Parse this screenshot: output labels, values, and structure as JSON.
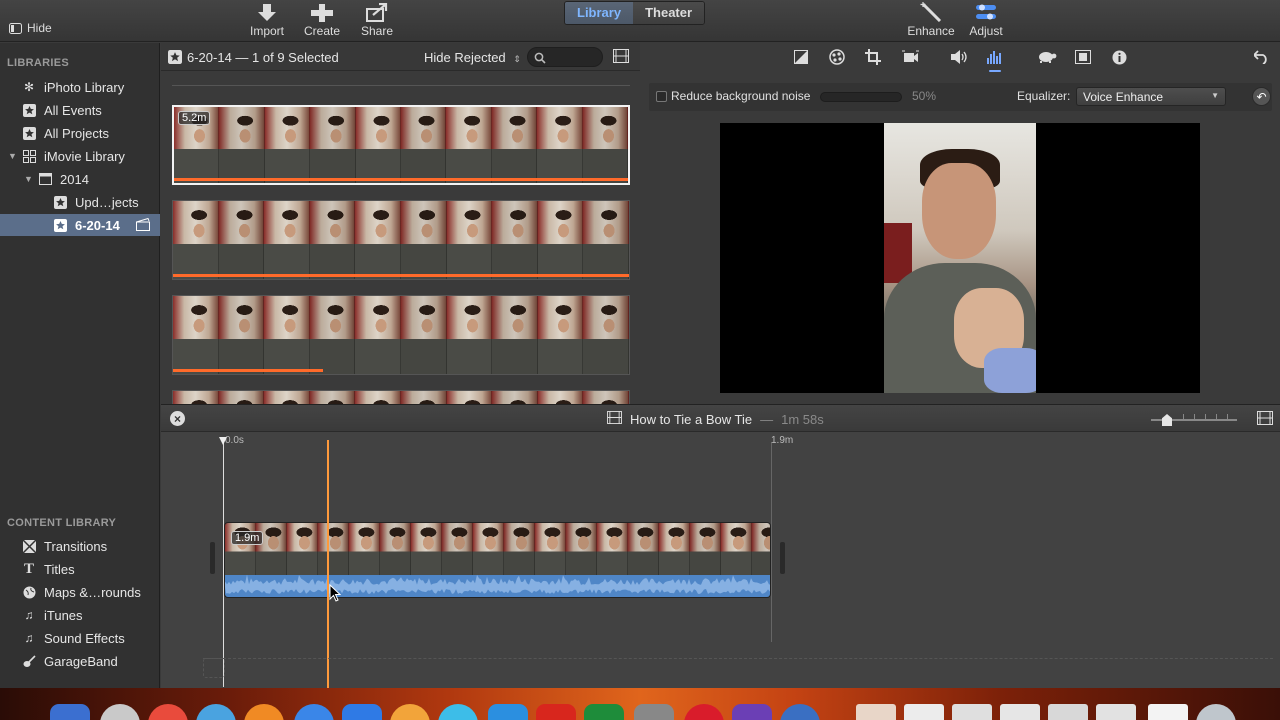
{
  "toolbar": {
    "hide_label": "Hide",
    "import_label": "Import",
    "create_label": "Create",
    "share_label": "Share",
    "library_tab": "Library",
    "theater_tab": "Theater",
    "enhance_label": "Enhance",
    "adjust_label": "Adjust"
  },
  "sidebar": {
    "libraries_header": "LIBRARIES",
    "items": [
      {
        "label": "iPhoto Library",
        "icon": "iphoto-icon"
      },
      {
        "label": "All Events",
        "icon": "star-icon"
      },
      {
        "label": "All Projects",
        "icon": "star-icon"
      },
      {
        "label": "iMovie Library",
        "icon": "grid-icon"
      },
      {
        "label": "2014",
        "icon": "calendar-icon"
      },
      {
        "label": "Upd…jects",
        "icon": "star-icon"
      },
      {
        "label": "6-20-14",
        "icon": "star-icon",
        "selected": true
      }
    ],
    "content_header": "CONTENT LIBRARY",
    "content_items": [
      {
        "label": "Transitions",
        "icon": "transitions-icon"
      },
      {
        "label": "Titles",
        "icon": "titles-icon"
      },
      {
        "label": "Maps &…rounds",
        "icon": "globe-icon"
      },
      {
        "label": "iTunes",
        "icon": "music-note-icon"
      },
      {
        "label": "Sound Effects",
        "icon": "music-note-icon"
      },
      {
        "label": "GarageBand",
        "icon": "guitar-icon"
      }
    ]
  },
  "browser": {
    "title": "6-20-14 — 1 of 9 Selected",
    "filter": "Hide Rejected",
    "first_clip_duration": "5.2m"
  },
  "viewer": {
    "reduce_noise_label": "Reduce background noise",
    "noise_percent": "50%",
    "equalizer_label": "Equalizer:",
    "equalizer_value": "Voice Enhance"
  },
  "project": {
    "title": "How to Tie a Bow Tie",
    "separator": "—",
    "duration": "1m 58s",
    "ruler_start": "0.0s",
    "ruler_mark": "1.9m",
    "clip_duration": "1.9m"
  },
  "colors": {
    "accent": "#78a8ff",
    "playhead": "#ff9a3c",
    "audio": "#4f86c7",
    "selection": "#5b6e8a"
  }
}
